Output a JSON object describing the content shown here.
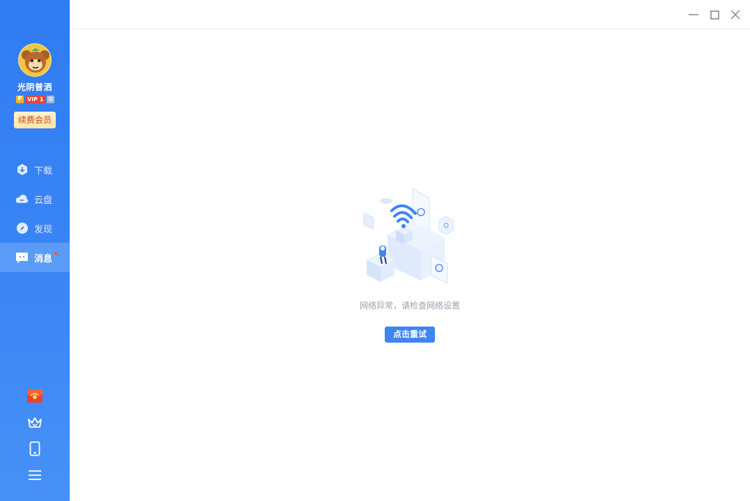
{
  "user": {
    "name": "光阴普洒",
    "badge_p": "P",
    "badge_vip": "VIP 1",
    "badge_year": "年",
    "renew_label": "续费会员"
  },
  "nav": {
    "items": [
      {
        "label": "下载",
        "icon": "download-icon"
      },
      {
        "label": "云盘",
        "icon": "cloud-icon"
      },
      {
        "label": "发现",
        "icon": "compass-icon"
      },
      {
        "label": "消息",
        "icon": "message-icon",
        "active": true,
        "has_dot": true
      }
    ]
  },
  "bottom_icons": [
    "gift-icon",
    "crown-icon",
    "phone-icon",
    "menu-icon"
  ],
  "window_controls": [
    "minimize-icon",
    "maximize-icon",
    "close-icon"
  ],
  "content": {
    "error_message": "网络异常，请检查网络设置",
    "retry_label": "点击重试"
  },
  "colors": {
    "sidebar_accent": "#2f7bf0",
    "active_item": "#5a9bf8",
    "retry_button": "#3d84f5",
    "renew_text": "#c4441a"
  }
}
